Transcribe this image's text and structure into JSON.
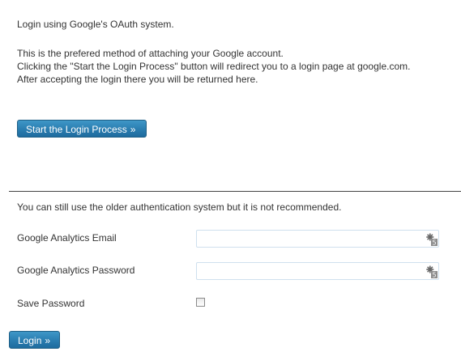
{
  "oauth": {
    "intro": "Login using Google's OAuth system.",
    "description_lines": [
      "This is the prefered method of attaching your Google account.",
      "Clicking the \"Start the Login Process\" button will redirect you to a login page at google.com.",
      "After accepting the login there you will be returned here."
    ],
    "start_button_label": "Start the Login Process",
    "button_arrow": "»"
  },
  "legacy": {
    "notice": "You can still use the older authentication system but it is not recommended.",
    "email_label": "Google Analytics Email",
    "email_value": "",
    "password_label": "Google Analytics Password",
    "password_value": "",
    "save_password_label": "Save Password",
    "save_password_checked": false,
    "login_button_label": "Login",
    "button_arrow": "»"
  },
  "colors": {
    "button_blue": "#2a7db0",
    "divider": "#444444",
    "field_border": "#cfe0ee"
  },
  "icons": {
    "field_icon": "password-manager-icon"
  }
}
